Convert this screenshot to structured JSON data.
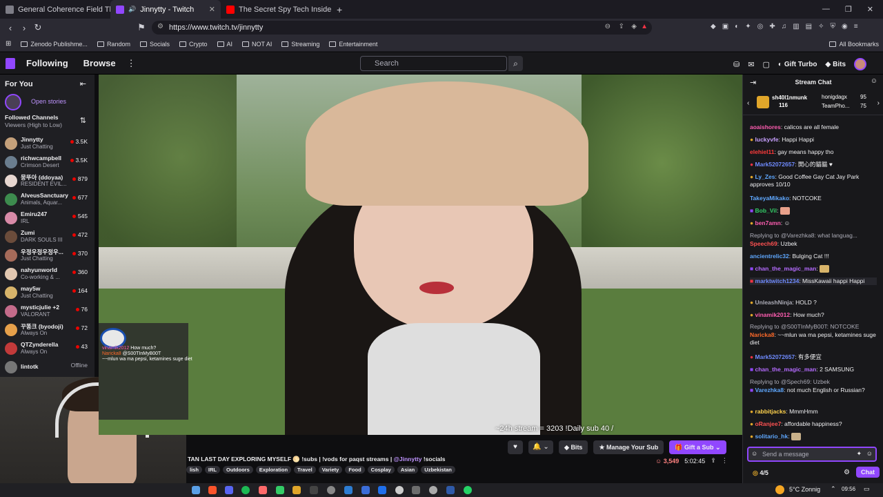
{
  "browser": {
    "tabs": [
      {
        "label": "General Coherence Field Theory (GC",
        "color": "#7d7d86"
      },
      {
        "label": "Jinnytty - Twitch",
        "color": "#9147ff"
      },
      {
        "label": "The Secret Spy Tech Inside Every Cre",
        "color": "#ff0000"
      }
    ],
    "new_tab": "+",
    "url": "https://www.twitch.tv/jinnytty",
    "bookmarks": [
      "Zenodo Publishme...",
      "Random",
      "Socials",
      "Crypto",
      "AI",
      "NOT AI",
      "Streaming",
      "Entertainment"
    ],
    "all_bookmarks": "All Bookmarks"
  },
  "twitch": {
    "following": "Following",
    "browse": "Browse",
    "search_placeholder": "Search",
    "gift_turbo": "Gift Turbo",
    "bits": "Bits",
    "brand_color": "#9147ff",
    "live_color": "#eb0400"
  },
  "sidebar": {
    "for_you": "For You",
    "open_stories": "Open stories",
    "followed_title": "Followed Channels",
    "followed_sort": "Viewers (High to Low)",
    "channels": [
      {
        "name": "Jinnytty",
        "game": "Just Chatting",
        "viewers": "3.5K",
        "color": "#c4a07a"
      },
      {
        "name": "richwcampbell",
        "game": "Crimson Desert",
        "viewers": "3.5K",
        "color": "#6a7d8e"
      },
      {
        "name": "뭉뚜아 (ddoyaa)",
        "game": "RESIDENT EVIL...",
        "viewers": "879",
        "color": "#e7d6d0"
      },
      {
        "name": "AlveusSanctuary",
        "game": "Animals, Aquar...",
        "viewers": "677",
        "color": "#3d8b4e"
      },
      {
        "name": "Emiru247",
        "game": "IRL",
        "viewers": "545",
        "color": "#d88aa8"
      },
      {
        "name": "Zumi",
        "game": "DARK SOULS III",
        "viewers": "472",
        "color": "#6b4c3b"
      },
      {
        "name": "우정우정우정우...",
        "game": "Just Chatting",
        "viewers": "370",
        "color": "#a66b5a"
      },
      {
        "name": "nahyunworld",
        "game": "Co-working & ...",
        "viewers": "360",
        "color": "#e2c7b0"
      },
      {
        "name": "may5w",
        "game": "Just Chatting",
        "viewers": "164",
        "color": "#d8b46a"
      },
      {
        "name": "mysticjulie +2",
        "game": "VALORANT",
        "viewers": "76",
        "color": "#c46b8a"
      },
      {
        "name": "꾸똥크 (byodoji)",
        "game": "Always On",
        "viewers": "72",
        "color": "#e6a04a"
      },
      {
        "name": "QTZynderella",
        "game": "Always On",
        "viewers": "43",
        "color": "#c23a3a"
      },
      {
        "name": "lintotk",
        "game": "",
        "viewers": "Offline",
        "color": "#777"
      }
    ]
  },
  "stream": {
    "overlay_counter": "~24h stream = 3203   !Daily sub 40 /",
    "overlay_chat": [
      {
        "user": "vinamik2012",
        "text": "How much?"
      },
      {
        "user": "Naricka8",
        "text": "@S00TInMyB00T"
      },
      {
        "user": "",
        "text": "~~mlun wa ma pepsi, ketamines suge diet"
      }
    ],
    "title": "TAN LAST DAY EXPLORING MYSELF 🌕 !subs | !vods for paqst streams |",
    "mention": "@Jinnytty",
    "socials": "!socials",
    "tags": [
      "lish",
      "IRL",
      "Outdoors",
      "Exploration",
      "Travel",
      "Variety",
      "Food",
      "Cosplay",
      "Asian",
      "Uzbekistan"
    ],
    "bits": "Bits",
    "manage_sub": "Manage Your Sub",
    "gift_sub": "Gift a Sub",
    "viewers": "3,549",
    "uptime": "5:02:45"
  },
  "chat": {
    "title": "Stream Chat",
    "leaderboard": [
      {
        "name": "sh40l1nmunk",
        "count": "116"
      },
      {
        "name": "honigdagx",
        "count": "95"
      },
      {
        "name": "TeamPho...",
        "count": "75"
      }
    ],
    "messages": [
      {
        "user": "aoaishores",
        "color": "#ff5db1",
        "text": "calicos are all female"
      },
      {
        "user": "luckyvfe",
        "color": "#c8a0ff",
        "text": "Happi Happi"
      },
      {
        "user": "elehiel11",
        "color": "#ff3b3b",
        "text": "gay means happy tho"
      },
      {
        "user": "Mark52072657",
        "color": "#6f8bff",
        "text": "開心的貓貓"
      },
      {
        "user": "Ly_Zes",
        "color": "#5fa8ff",
        "text": "Good Coffee Gay Cat Jay Park approves 10/10"
      },
      {
        "user": "TakeyaMikako",
        "color": "#5fa8ff",
        "text": "NOTCOKE"
      },
      {
        "user": "Bob_Vil",
        "color": "#33cc66",
        "text": ""
      },
      {
        "user": "ben7amn",
        "color": "#ff5db1",
        "text": ""
      },
      {
        "user": "Speech69",
        "color": "#ff5252",
        "reply": "Replying to @Varezhka8: what languag...",
        "text": "Uzbek"
      },
      {
        "user": "ancientrelic32",
        "color": "#5fa8ff",
        "text": "Bulging Cat !!!"
      },
      {
        "user": "chan_the_magic_man",
        "color": "#b56bff",
        "text": ""
      },
      {
        "user": "marktwitch1234",
        "color": "#6f8bff",
        "text": "MissKawaii happi Happi"
      },
      {
        "user": "UnleashNinja",
        "color": "#adadb8",
        "text": "HOLD ?"
      },
      {
        "user": "vinamik2012",
        "color": "#ff5db1",
        "text": "How much?"
      },
      {
        "user": "Naricka8",
        "color": "#ff6a2a",
        "reply": "Replying to @S00TInMyB00T: NOTCOKE",
        "text": "~~mlun wa ma pepsi, ketamines suge diet"
      },
      {
        "user": "Mark52072657",
        "color": "#6f8bff",
        "text": "有多便宜"
      },
      {
        "user": "chan_the_magic_man",
        "color": "#b56bff",
        "text": "2 SAMSUNG"
      },
      {
        "user": "Varezhka8",
        "color": "#5fa8ff",
        "reply": "Replying to @Spech69: Uzbek",
        "text": "not much English or Russian?"
      },
      {
        "user": "rabbitjacks",
        "color": "#ffd34d",
        "text": "MmmHmm"
      },
      {
        "user": "oRanjee7",
        "color": "#ff5252",
        "text": "affordable happiness?"
      },
      {
        "user": "solitario_hk",
        "color": "#5fa8ff",
        "text": ""
      }
    ],
    "input_placeholder": "Send a message",
    "points": "4/5",
    "chat_button": "Chat"
  },
  "taskbar": {
    "weather": "5°C  Zonnig",
    "time": "09:56"
  }
}
